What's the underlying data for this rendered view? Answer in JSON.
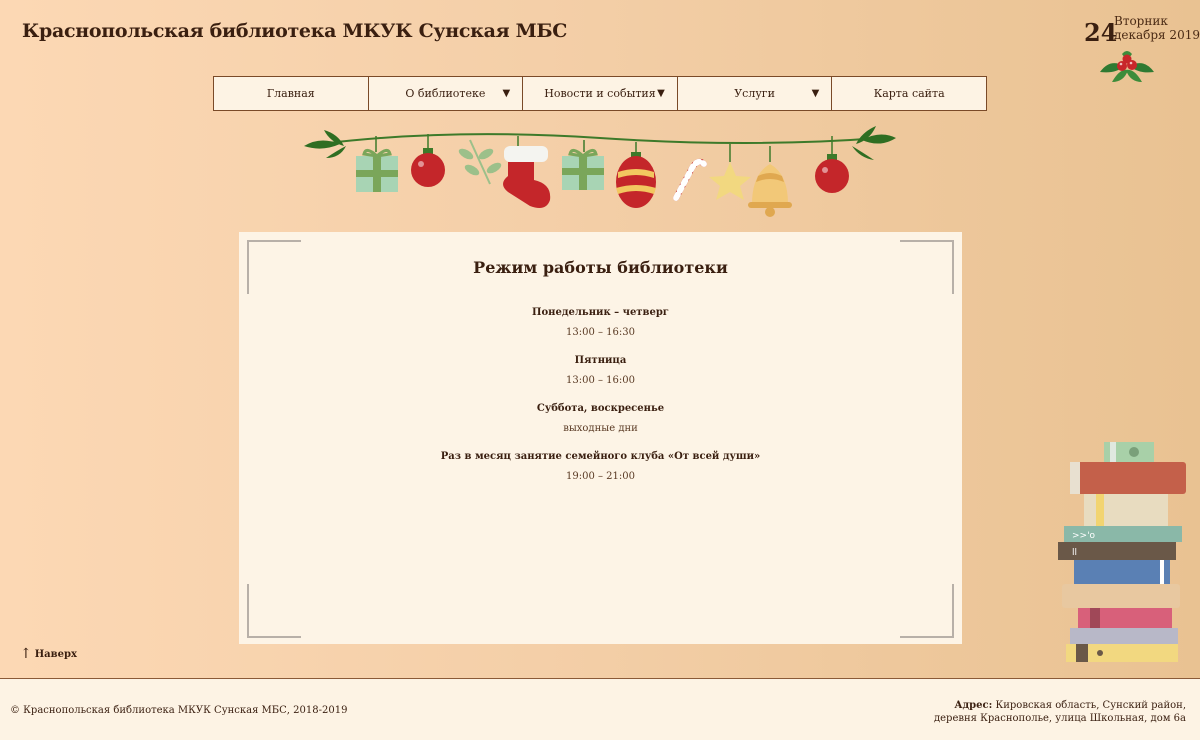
{
  "header": {
    "site_title": "Краснопольская библиотека МКУК Сунская МБС",
    "date_day": "24",
    "date_weekday": "Вторник",
    "date_month_year": "декабря 2019"
  },
  "nav": {
    "items": [
      {
        "label": "Главная",
        "has_dropdown": false
      },
      {
        "label": "О библиотеке",
        "has_dropdown": true
      },
      {
        "label": "Новости и события",
        "has_dropdown": true
      },
      {
        "label": "Услуги",
        "has_dropdown": true
      },
      {
        "label": "Карта сайта",
        "has_dropdown": false
      }
    ],
    "dropdown_glyph": "▼"
  },
  "content": {
    "title": "Режим работы библиотеки",
    "schedule": [
      {
        "label": "Понедельник – четверг",
        "value": "13:00 – 16:30"
      },
      {
        "label": "Пятница",
        "value": "13:00 – 16:00"
      },
      {
        "label": "Суббота, воскресенье",
        "value": "выходные дни"
      },
      {
        "label": "Раз в месяц занятие семейного клуба «От всей души»",
        "value": "19:00 – 21:00"
      }
    ]
  },
  "to_top": {
    "arrow": "↑",
    "label": "Наверх"
  },
  "footer": {
    "copyright": "© Краснопольская библиотека МКУК Сунская МБС, 2018-2019",
    "address_label": "Адрес:",
    "address_line1": "Кировская область, Сунский район,",
    "address_line2": "деревня Краснополье, улица Школьная, дом 6а"
  },
  "colors": {
    "background_left": "#fcd8b4",
    "background_right": "#e9c292",
    "text_dark": "#3a1f10",
    "card_bg": "#fdf4e6",
    "nav_border": "#7a4a28"
  },
  "icons": {
    "holly": "holly-icon",
    "garland": "christmas-garland-icon",
    "books": "book-stack-icon",
    "dropdown": "chevron-down-icon",
    "to_top": "arrow-up-icon"
  }
}
